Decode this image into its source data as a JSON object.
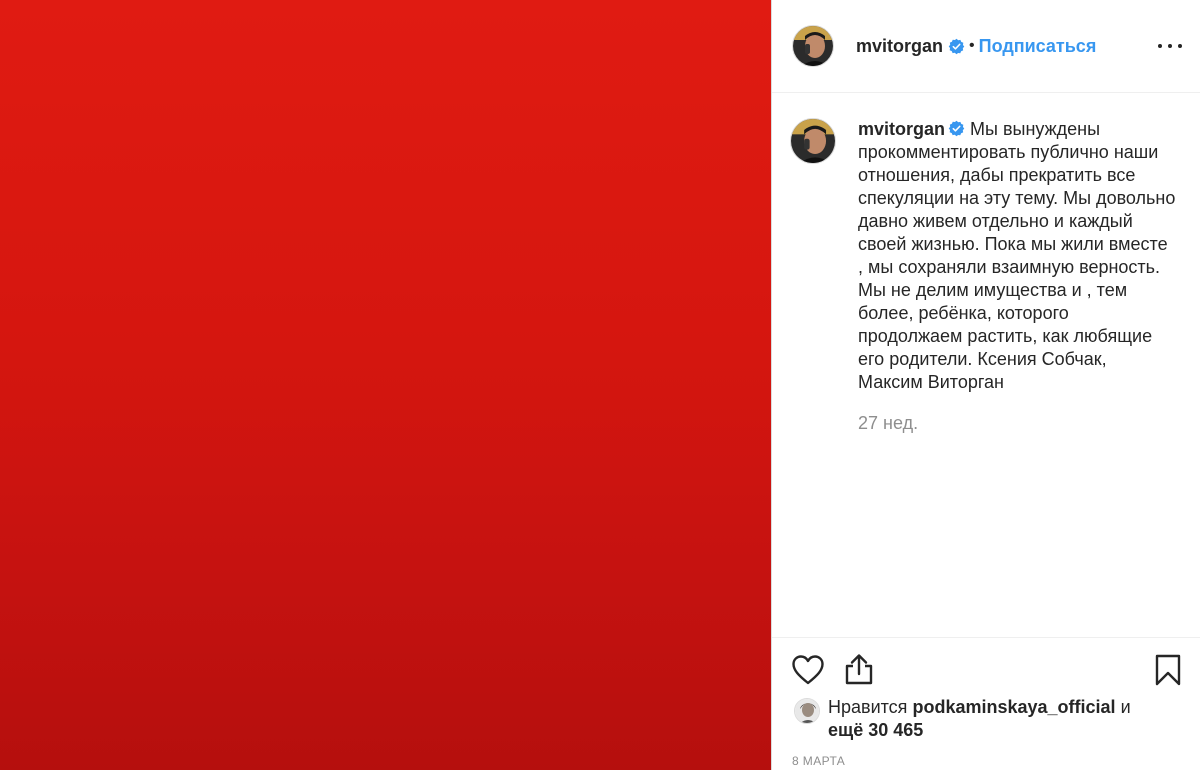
{
  "post": {
    "media": {
      "color_top": "#e01b12",
      "color_bottom": "#b50f0d"
    },
    "header": {
      "username": "mvitorgan",
      "separator": "•",
      "follow_label": "Подписаться"
    },
    "caption": {
      "username": "mvitorgan",
      "text": "Мы вынуждены прокомментировать публично наши отношения, дабы прекратить все спекуляции на эту тему. Мы довольно давно живем отдельно и каждый своей жизнью. Пока мы жили вместе , мы сохраняли взаимную верность. Мы не делим имущества и , тем более, ребёнка, которого продолжаем растить, как любящие его родители. Ксения Собчак, Максим Виторган",
      "time_ago": "27 нед."
    },
    "actions": {
      "like_icon": "heart-icon",
      "share_icon": "share-icon",
      "save_icon": "bookmark-icon"
    },
    "likes": {
      "prefix": "Нравится",
      "liker": "podkaminskaya_official",
      "suffix_and": "и",
      "count_text": "ещё 30 465"
    },
    "date": "8 марта",
    "colors": {
      "accent": "#3897f0",
      "text": "#262626",
      "muted": "#8e8e8e"
    }
  }
}
